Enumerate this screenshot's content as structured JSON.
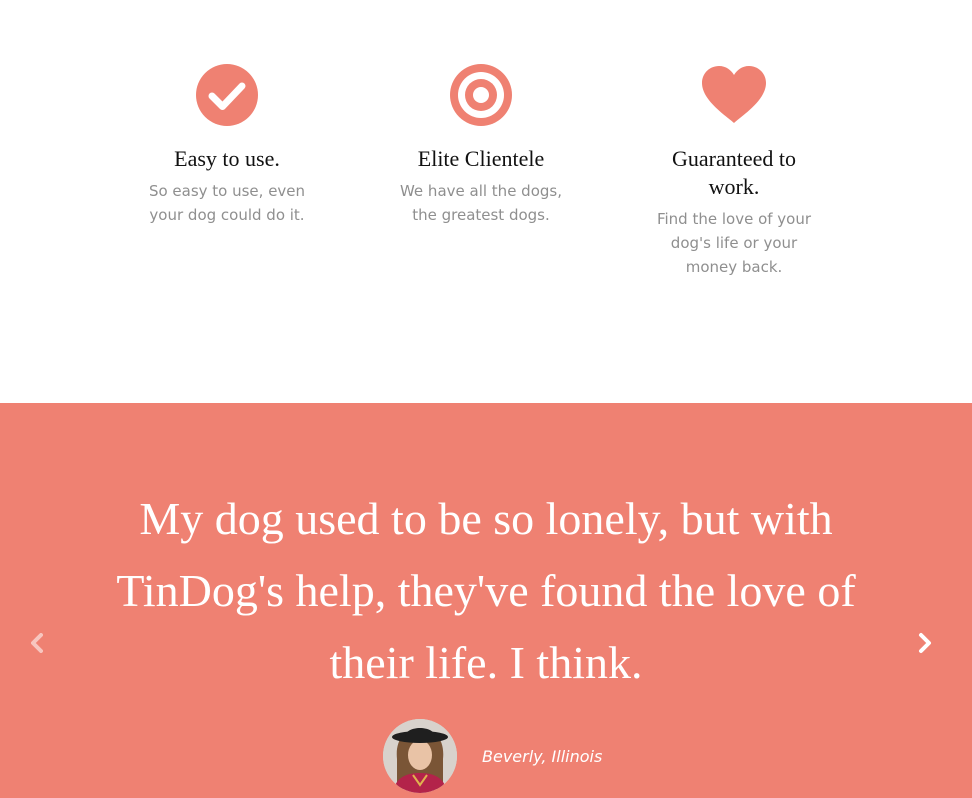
{
  "colors": {
    "accent": "#ef8172",
    "text_dark": "#111111",
    "text_muted": "#8f8f8f",
    "white": "#ffffff"
  },
  "features": [
    {
      "icon": "check-circle-icon",
      "title": "Easy to use.",
      "text": "So easy to use, even your dog could do it."
    },
    {
      "icon": "bullseye-icon",
      "title": "Elite Clientele",
      "text": "We have all the dogs, the greatest dogs."
    },
    {
      "icon": "heart-icon",
      "title": "Guaranteed to work.",
      "text": "Find the love of your dog's life or your money back."
    }
  ],
  "testimonial": {
    "quote": "My dog used to be so lonely, but with TinDog's help, they've found the love of their life. I think.",
    "author": "Beverly, Illinois",
    "prev_icon": "chevron-left-icon",
    "next_icon": "chevron-right-icon"
  }
}
